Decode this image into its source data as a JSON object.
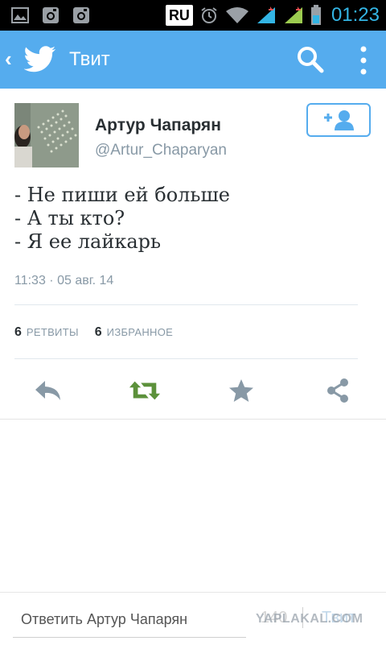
{
  "status_bar": {
    "language_badge": "RU",
    "time": "01:23",
    "icons": [
      "image-icon",
      "instagram-icon",
      "instagram-icon",
      "alarm-icon",
      "wifi-icon",
      "signal-1-icon",
      "signal-2-icon",
      "battery-icon"
    ]
  },
  "app_bar": {
    "title": "Твит",
    "accent_color": "#55acee"
  },
  "tweet": {
    "author_name": "Артур Чапарян",
    "author_handle": "@Artur_Chaparyan",
    "lines": [
      "- Не пиши ей больше",
      "- А ты кто?",
      "- Я ее лайкарь"
    ],
    "timestamp": "11:33 · 05 авг. 14",
    "retweets_count": "6",
    "retweets_label": "РЕТВИТЫ",
    "favorites_count": "6",
    "favorites_label": "ИЗБРАННОЕ"
  },
  "actions": {
    "icons": [
      "reply-icon",
      "retweet-icon",
      "favorite-icon",
      "share-icon"
    ],
    "retweet_color": "#5c913b"
  },
  "reply_bar": {
    "placeholder": "Ответить Артур Чапарян",
    "char_count": "140",
    "tweet_label": "Твит"
  },
  "watermark": "YAPLAKAL.COM"
}
